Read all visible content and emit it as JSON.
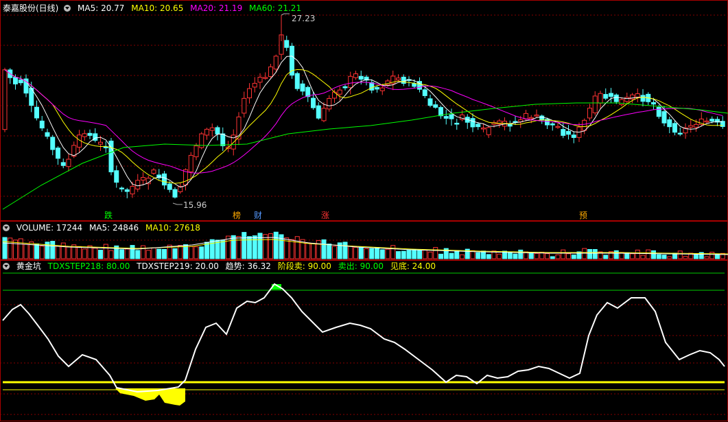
{
  "main": {
    "title": "泰嘉股份(日线)",
    "ma": [
      {
        "label": "MA5: 20.77",
        "color": "#ffffff"
      },
      {
        "label": "MA10: 20.65",
        "color": "#ffff00"
      },
      {
        "label": "MA20: 21.19",
        "color": "#ff00ff"
      },
      {
        "label": "MA60: 21.21",
        "color": "#00ff00"
      }
    ],
    "high_label": "27.23",
    "low_label": "15.96",
    "signals": [
      {
        "text": "跌",
        "color": "#00ff00"
      },
      {
        "text": "榜",
        "color": "#ffaa00"
      },
      {
        "text": "财",
        "color": "#5599ff"
      },
      {
        "text": "涨",
        "color": "#ff3333"
      },
      {
        "text": "预",
        "color": "#ffaa00"
      }
    ]
  },
  "volume": {
    "items": [
      {
        "label": "VOLUME: 17244",
        "color": "#ffffff"
      },
      {
        "label": "MA5: 24846",
        "color": "#ffffff"
      },
      {
        "label": "MA10: 27618",
        "color": "#ffff00"
      }
    ]
  },
  "indicator": {
    "items": [
      {
        "label": "黄金坑",
        "color": "#ffffff"
      },
      {
        "label": "TDXSTEP218: 80.00",
        "color": "#00ff00"
      },
      {
        "label": "TDXSTEP219: 20.00",
        "color": "#ffffff"
      },
      {
        "label": "趋势: 36.32",
        "color": "#ffffff"
      },
      {
        "label": "阶段卖: 90.00",
        "color": "#ffff00"
      },
      {
        "label": "卖出: 90.00",
        "color": "#00ff00"
      },
      {
        "label": "见底: 24.00",
        "color": "#ffff00"
      }
    ]
  },
  "colors": {
    "up": "#ff3333",
    "down": "#54ffff",
    "frame": "#aa0000"
  }
}
